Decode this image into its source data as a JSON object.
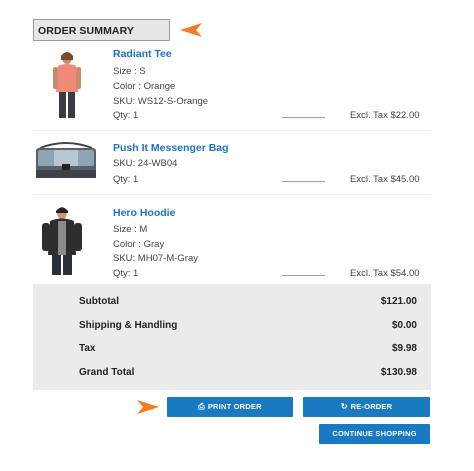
{
  "summary": {
    "title": "ORDER SUMMARY"
  },
  "items": [
    {
      "name": "Radiant Tee",
      "options": [
        "Size : S",
        "Color : Orange",
        "SKU: WS12-S-Orange"
      ],
      "qty": "Qty: 1",
      "price": "Excl. Tax $22.00",
      "image": "pink-tee-photo"
    },
    {
      "name": "Push It Messenger Bag",
      "options": [
        "SKU: 24-WB04"
      ],
      "qty": "Qty: 1",
      "price": "Excl. Tax $45.00",
      "image": "messenger-bag-photo"
    },
    {
      "name": "Hero Hoodie",
      "options": [
        "Size : M",
        "Color : Gray",
        "SKU: MH07-M-Gray"
      ],
      "qty": "Qty: 1",
      "price": "Excl. Tax $54.00",
      "image": "gray-hoodie-photo"
    }
  ],
  "totals": [
    {
      "label": "Subtotal",
      "value": "$121.00"
    },
    {
      "label": "Shipping & Handling",
      "value": "$0.00"
    },
    {
      "label": "Tax",
      "value": "$9.98"
    },
    {
      "label": "Grand Total",
      "value": "$130.98"
    }
  ],
  "buttons": {
    "print": "PRINT ORDER",
    "reorder": "RE-ORDER",
    "continue": "CONTINUE SHOPPING"
  },
  "colors": {
    "accent": "#1979c3",
    "arrow": "#f47b20",
    "totals_bg": "#e9ecea",
    "link": "#1a73c5"
  }
}
